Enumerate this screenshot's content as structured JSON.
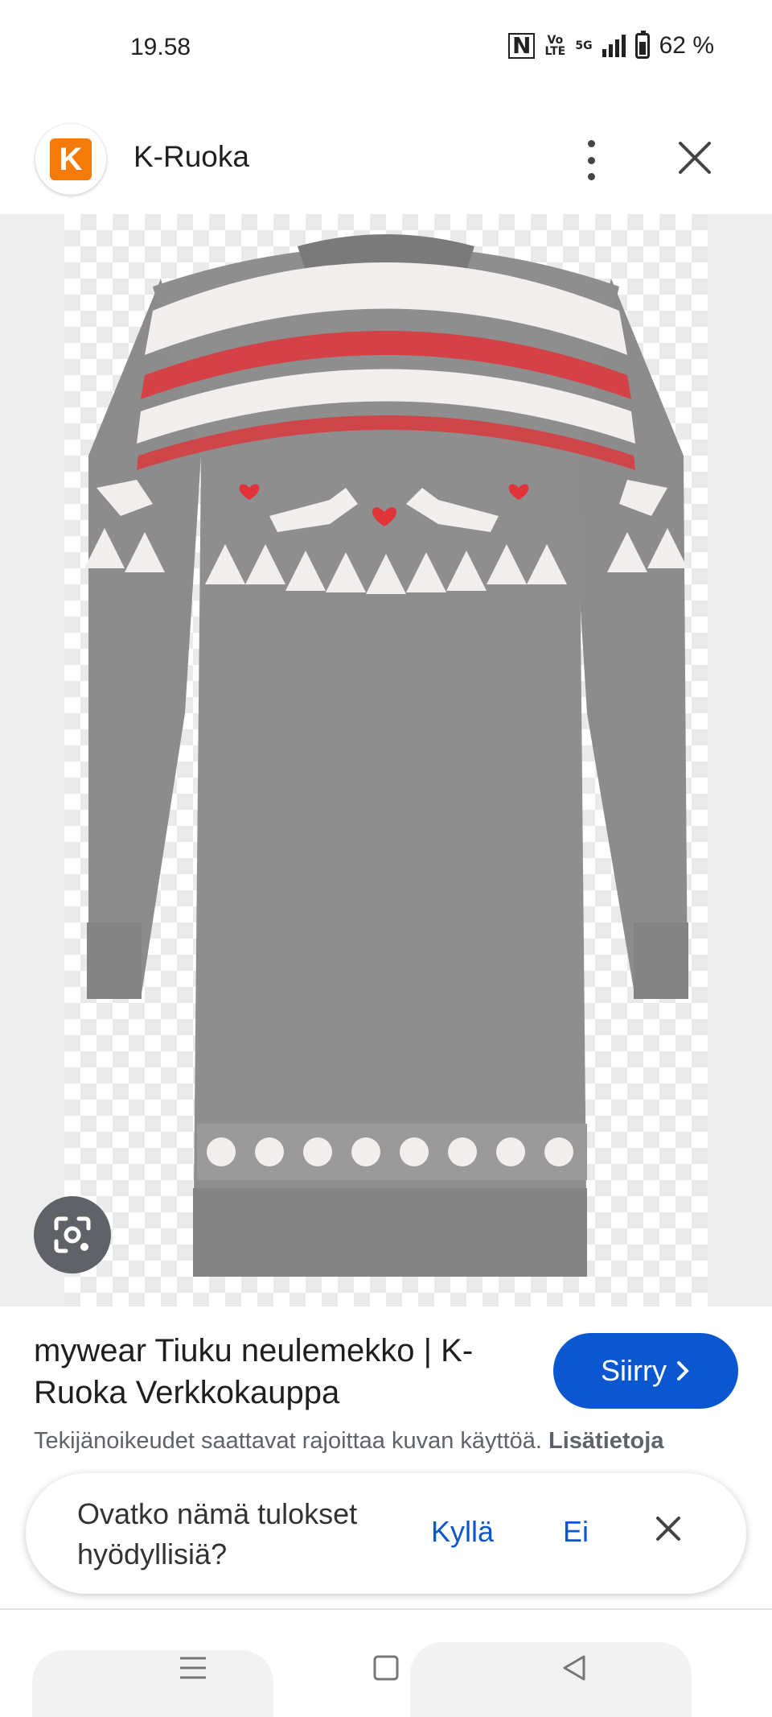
{
  "status_bar": {
    "time": "19.58",
    "nfc_label": "N",
    "volte_label": "Vo LTE",
    "network_label": "5G",
    "battery_text": "62 %"
  },
  "header": {
    "logo_letter": "K",
    "site_name": "K-Ruoka",
    "icons": [
      "more-vert-icon",
      "close-icon"
    ]
  },
  "result": {
    "title": "mywear Tiuku neulemekko | K-Ruoka Verkkokauppa",
    "visit_label": "Siirry",
    "copyright_text": "Tekijänoikeudet saattavat rajoittaa kuvan käyttöä.",
    "more_info_label": "Lisätietoja"
  },
  "feedback": {
    "question": "Ovatko nämä tulokset hyödyllisiä?",
    "yes_label": "Kyllä",
    "no_label": "Ei"
  },
  "colors": {
    "accent_blue": "#0b57d0",
    "k_orange": "#f47b0a",
    "sweater_grey": "#8e8e8e",
    "pattern_red": "#e0343a"
  }
}
